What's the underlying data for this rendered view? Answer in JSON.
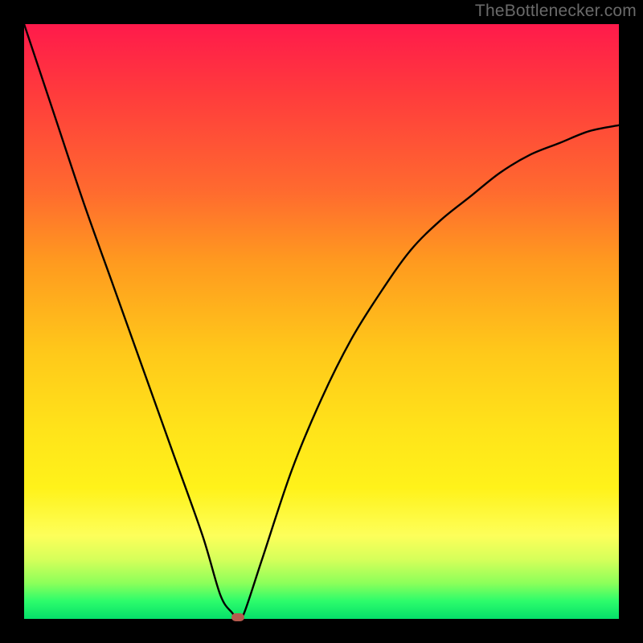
{
  "watermark": {
    "text": "TheBottlenecker.com"
  },
  "chart_data": {
    "type": "line",
    "title": "",
    "xlabel": "",
    "ylabel": "",
    "xlim": [
      0,
      100
    ],
    "ylim": [
      0,
      100
    ],
    "series": [
      {
        "name": "bottleneck-curve",
        "x": [
          0,
          5,
          10,
          15,
          20,
          25,
          30,
          33,
          35,
          36,
          37,
          40,
          45,
          50,
          55,
          60,
          65,
          70,
          75,
          80,
          85,
          90,
          95,
          100
        ],
        "values": [
          100,
          85,
          70,
          56,
          42,
          28,
          14,
          4,
          1,
          0,
          1,
          10,
          25,
          37,
          47,
          55,
          62,
          67,
          71,
          75,
          78,
          80,
          82,
          83
        ]
      }
    ],
    "marker": {
      "x": 36,
      "y": 0
    },
    "gradient_stops": [
      {
        "pos": 0,
        "color": "#ff1a4b"
      },
      {
        "pos": 12,
        "color": "#ff3c3c"
      },
      {
        "pos": 28,
        "color": "#ff6a2f"
      },
      {
        "pos": 40,
        "color": "#ff9a1f"
      },
      {
        "pos": 55,
        "color": "#ffc81a"
      },
      {
        "pos": 68,
        "color": "#ffe31a"
      },
      {
        "pos": 78,
        "color": "#fff21a"
      },
      {
        "pos": 86,
        "color": "#fdff5a"
      },
      {
        "pos": 90,
        "color": "#d6ff5a"
      },
      {
        "pos": 94,
        "color": "#8cff5a"
      },
      {
        "pos": 97,
        "color": "#2dfc6b"
      },
      {
        "pos": 100,
        "color": "#05e06a"
      }
    ]
  },
  "colors": {
    "frame": "#000000",
    "curve": "#000000",
    "marker": "#b65a4e",
    "watermark": "#6a6a6a"
  },
  "layout": {
    "image_size": 800,
    "plot_inset": 30,
    "plot_size": 740
  }
}
